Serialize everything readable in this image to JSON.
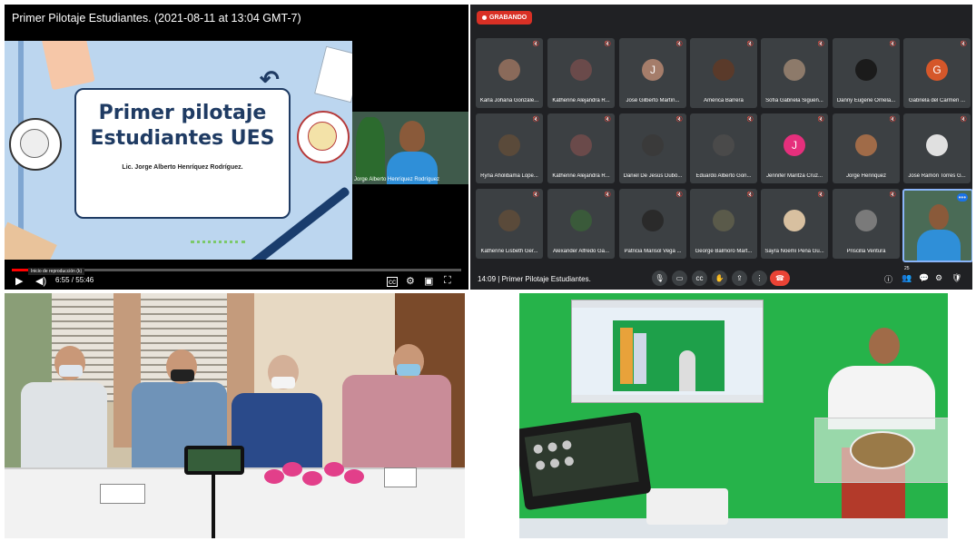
{
  "video": {
    "title": "Primer Pilotaje Estudiantes. (2021-08-11 at 13:04 GMT-7)",
    "slide_title_line1": "Primer pilotaje",
    "slide_title_line2": "Estudiantes UES",
    "slide_author": "Lic. Jorge Alberto Henríquez Rodríguez.",
    "cam_name": "Jorge Alberto Henríquez Rodríguez",
    "tooltip": "Inicio de reproducción (k)",
    "time": "6:55 / 55:46",
    "progress_fraction": 0.125,
    "icons": [
      "play-icon",
      "volume-icon",
      "subtitles-icon",
      "settings-icon",
      "miniplayer-icon",
      "fullscreen-icon"
    ]
  },
  "meeting": {
    "recording_label": "GRABANDO",
    "time": "14:09",
    "meeting_name": "Primer Pilotaje Estudiantes.",
    "participants": [
      {
        "name": "Karla Johana Gonzále...",
        "initial": "",
        "color": "#8a6a5a"
      },
      {
        "name": "Katherine Alejandra R...",
        "initial": "",
        "color": "#6a4a4a"
      },
      {
        "name": "José Gilberto Martín...",
        "initial": "J",
        "color": "#a57d6a"
      },
      {
        "name": "América Barrera",
        "initial": "",
        "color": "#5a3a2a"
      },
      {
        "name": "Sofía Gabriela Siguen...",
        "initial": "",
        "color": "#8d7a6a"
      },
      {
        "name": "Danny Eugene Ornela...",
        "initial": "",
        "color": "#1b1b1b"
      },
      {
        "name": "Gabriela del Carmen ...",
        "initial": "G",
        "color": "#d5572a"
      },
      {
        "name": "Ryna Aholibama Lope...",
        "initial": "",
        "color": "#5a4a3a"
      },
      {
        "name": "Katherine Alejandra R...",
        "initial": "",
        "color": "#6a4a4a"
      },
      {
        "name": "Daniel De Jesús Dubó...",
        "initial": "",
        "color": "#3a3a3a"
      },
      {
        "name": "Eduardo Alberto Gon...",
        "initial": "",
        "color": "#4a4a4a"
      },
      {
        "name": "Jennifer Maritza Cruz...",
        "initial": "J",
        "color": "#e52f7c"
      },
      {
        "name": "Jorge Henriquez",
        "initial": "",
        "color": "#a06b48"
      },
      {
        "name": "José Ramón Torres G...",
        "initial": "",
        "color": "#e0e0e0"
      },
      {
        "name": "Katherine Lisbeth Ger...",
        "initial": "",
        "color": "#5a4a3a"
      },
      {
        "name": "Alexander Alfredo Ga...",
        "initial": "",
        "color": "#3a5a3a"
      },
      {
        "name": "Patricia Marisol Vega ...",
        "initial": "",
        "color": "#2a2a2a"
      },
      {
        "name": "George Balmoro Mart...",
        "initial": "",
        "color": "#5a5a4a"
      },
      {
        "name": "Sayra Noemí Peña Gu...",
        "initial": "",
        "color": "#d8c0a0"
      },
      {
        "name": "Priscilla Ventura",
        "initial": "",
        "color": "#7a7a7a"
      }
    ],
    "controls": [
      "mic-icon",
      "camera-icon",
      "captions-icon",
      "raise-hand-icon",
      "present-icon",
      "more-icon",
      "end-call-icon"
    ],
    "right_controls": [
      "info-icon",
      "people-icon",
      "chat-icon",
      "activities-icon",
      "host-controls-icon"
    ],
    "people_count": "25"
  }
}
